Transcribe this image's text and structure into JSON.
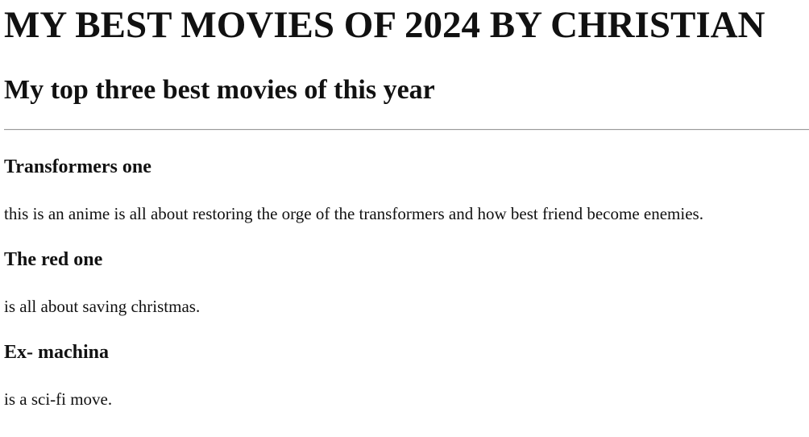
{
  "header": {
    "title": "MY BEST MOVIES OF 2024 BY CHRISTIAN",
    "subtitle": "My top three best movies of this year"
  },
  "movies": [
    {
      "title": "Transformers one",
      "description": "this is an anime is all about restoring the orge of the transformers and how best friend become enemies."
    },
    {
      "title": "The red one",
      "description": "is all about saving christmas."
    },
    {
      "title": "Ex- machina",
      "description": "is a sci-fi move."
    }
  ]
}
